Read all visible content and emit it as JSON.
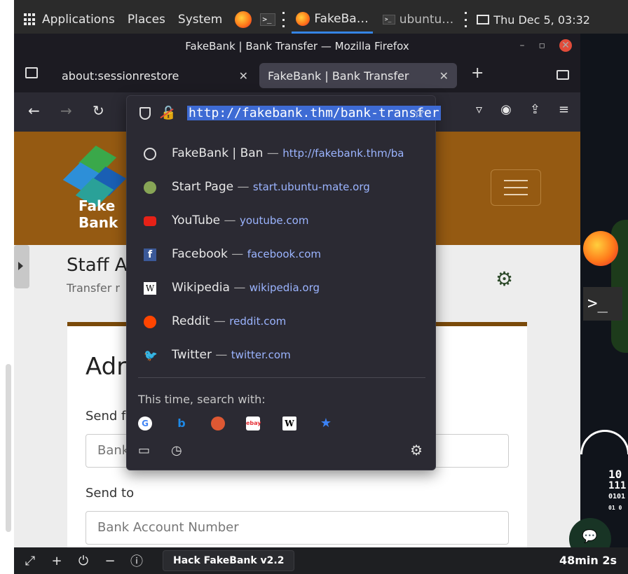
{
  "system_panel": {
    "menus": [
      "Applications",
      "Places",
      "System"
    ],
    "tasks": [
      {
        "label": "FakeBa…",
        "icon": "firefox-icon",
        "active": true
      },
      {
        "label": "ubuntu…",
        "icon": "terminal-icon",
        "active": false
      }
    ],
    "clock": "Thu Dec 5, 03:32"
  },
  "window": {
    "title": "FakeBank | Bank Transfer — Mozilla Firefox",
    "close_label": "✕"
  },
  "tabs": [
    {
      "label": "about:sessionrestore",
      "active": false
    },
    {
      "label": "FakeBank | Bank Transfer",
      "active": true
    }
  ],
  "urlbar": {
    "url": "http://fakebank.thm/bank-transfer"
  },
  "dropdown": {
    "suggestions": [
      {
        "title": "FakeBank | Ban",
        "url": "http://fakebank.thm/ba",
        "icon": "globe-icon"
      },
      {
        "title": "Start Page",
        "url": "start.ubuntu-mate.org",
        "icon": "ubuntu-mate-icon"
      },
      {
        "title": "YouTube",
        "url": "youtube.com",
        "icon": "youtube-icon"
      },
      {
        "title": "Facebook",
        "url": "facebook.com",
        "icon": "facebook-icon"
      },
      {
        "title": "Wikipedia",
        "url": "wikipedia.org",
        "icon": "wikipedia-icon"
      },
      {
        "title": "Reddit",
        "url": "reddit.com",
        "icon": "reddit-icon"
      },
      {
        "title": "Twitter",
        "url": "twitter.com",
        "icon": "twitter-icon"
      }
    ],
    "search_label": "This time, search with:",
    "engines": [
      "google",
      "bing",
      "duckduckgo",
      "ebay",
      "wikipedia",
      "bookmarks"
    ]
  },
  "page": {
    "logo_line1": "Fake",
    "logo_line2": "Bank",
    "staff_title": "Staff A",
    "staff_subtitle": "Transfer r",
    "card_title": "Adr",
    "send_from_label": "Send f",
    "send_from_placeholder": "Bank",
    "send_to_label": "Send to",
    "send_to_placeholder": "Bank Account Number"
  },
  "desktop": {
    "binary_lines": [
      "10",
      "111",
      "0101",
      "01  0"
    ]
  },
  "bottom_bar": {
    "task_label": "Hack FakeBank v2.2",
    "timer": "48min 2s"
  },
  "colors": {
    "header_brown": "#955a12",
    "url_selection": "#3e6bd4",
    "dropdown_bg": "#2b2a33"
  }
}
